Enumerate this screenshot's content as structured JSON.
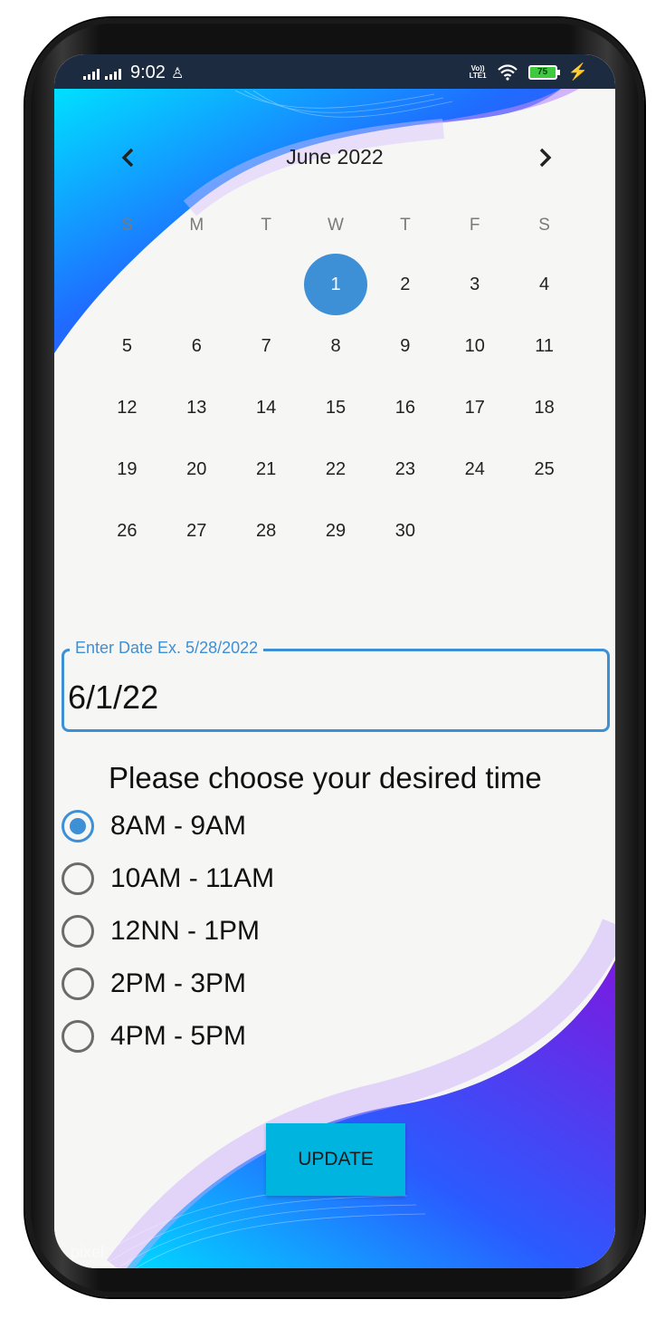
{
  "status_bar": {
    "time": "9:02",
    "volte_top": "Vo))",
    "volte_bottom": "LTE1",
    "battery": "75"
  },
  "calendar": {
    "month_title": "June 2022",
    "prev_icon": "chevron-left-icon",
    "next_icon": "chevron-right-icon",
    "weekdays": [
      "S",
      "M",
      "T",
      "W",
      "T",
      "F",
      "S"
    ],
    "weeks": [
      [
        "",
        "",
        "",
        "1",
        "2",
        "3",
        "4"
      ],
      [
        "5",
        "6",
        "7",
        "8",
        "9",
        "10",
        "11"
      ],
      [
        "12",
        "13",
        "14",
        "15",
        "16",
        "17",
        "18"
      ],
      [
        "19",
        "20",
        "21",
        "22",
        "23",
        "24",
        "25"
      ],
      [
        "26",
        "27",
        "28",
        "29",
        "30",
        "",
        ""
      ]
    ],
    "selected_day": "1",
    "accent_color": "#3d8fd6"
  },
  "date_field": {
    "label": "Enter Date Ex. 5/28/2022",
    "value": "6/1/22"
  },
  "time_section": {
    "title": "Please choose your desired time",
    "options": [
      "8AM - 9AM",
      "10AM - 11AM",
      "12NN - 1PM",
      "2PM - 3PM",
      "4PM - 5PM"
    ],
    "selected_index": 0
  },
  "update_button": {
    "label": "UPDATE",
    "color": "#00b4e0"
  },
  "watermark": "pixel"
}
